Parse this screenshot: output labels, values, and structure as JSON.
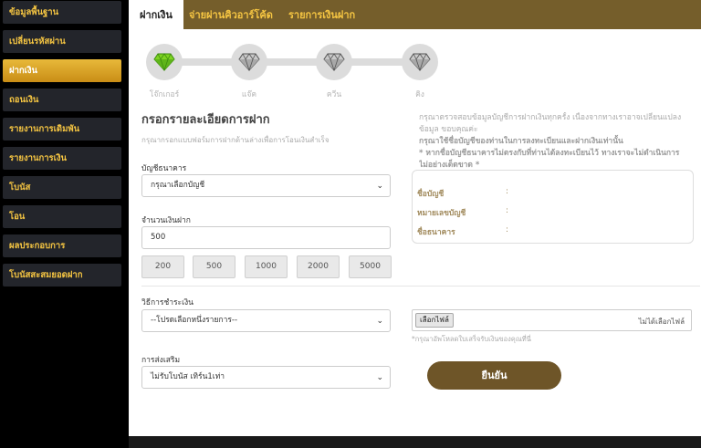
{
  "sidebar": {
    "items": [
      {
        "label": "ข้อมูลพื้นฐาน"
      },
      {
        "label": "เปลี่ยนรหัสผ่าน"
      },
      {
        "label": "ฝากเงิน"
      },
      {
        "label": "ถอนเงิน"
      },
      {
        "label": "รายงานการเดิมพัน"
      },
      {
        "label": "รายงานการเงิน"
      },
      {
        "label": "โบนัส"
      },
      {
        "label": "โอน"
      },
      {
        "label": "ผลประกอบการ"
      },
      {
        "label": "โบนัสสะสมยอดฝาก"
      }
    ],
    "active_index": 2
  },
  "tabs": [
    {
      "label": "ฝากเงิน"
    },
    {
      "label": "จ่ายผ่านคิวอาร์โค้ด"
    },
    {
      "label": "รายการเงินฝาก"
    }
  ],
  "steps": [
    {
      "label": "โจ๊กเกอร์",
      "icon": "diamond-green-icon"
    },
    {
      "label": "แจ๊ค",
      "icon": "diamond-gray-icon"
    },
    {
      "label": "ควีน",
      "icon": "diamond-gray-icon"
    },
    {
      "label": "คิง",
      "icon": "diamond-gray-icon"
    }
  ],
  "form": {
    "title": "กรอกรายละเอียดการฝาก",
    "subtitle": "กรุณากรอกแบบฟอร์มการฝากด้านล่างเพื่อการโอนเงินสำเร็จ",
    "bank_account_label": "บัญชีธนาคาร",
    "bank_account_value": "กรุณาเลือกบัญชี",
    "amount_label": "จำนวนเงินฝาก",
    "amount_value": "500",
    "amount_options": [
      "200",
      "500",
      "1000",
      "2000",
      "5000"
    ],
    "payment_method_label": "วิธีการชำระเงิน",
    "payment_method_value": "--โปรดเลือกหนึ่งรายการ--",
    "promotion_label": "การส่งเสริม",
    "promotion_value": "ไม่รับโบนัส เทิร์น1เท่า",
    "submit_label": "ยืนยัน"
  },
  "notice": {
    "line1": "กรุณาตรวจสอบข้อมูลบัญชีการฝากเงินทุกครั้ง เนื่องจากทางเราอาจเปลี่ยนแปลง",
    "line2": "ข้อมูล ขอบคุณค่ะ",
    "line3": "กรุณาใช้ชื่อบัญชีของท่านในการลงทะเบียนและฝากเงินเท่านั้น",
    "line4": "* หากชื่อบัญชีธนาคารไม่ตรงกับที่ท่านได้ลงทะเบียนไว้ ทางเราจะไม่ดำเนินการ",
    "line5": "ไม่อย่างเด็ดขาด *"
  },
  "bank_info": {
    "account_name_label": "ชื่อบัญชี",
    "account_number_label": "หมายเลขบัญชี",
    "bank_name_label": "ชื่อธนาคาร",
    "colon": ":"
  },
  "upload": {
    "button_label": "เลือกไฟล์",
    "status": "ไม่ได้เลือกไฟล์",
    "hint": "*กรุณาอัพโหลดใบเสร็จรับเงินของคุณที่นี่"
  },
  "colors": {
    "accent_gold": "#f5c542",
    "tab_bar": "#755e2b",
    "submit": "#6e5528"
  }
}
